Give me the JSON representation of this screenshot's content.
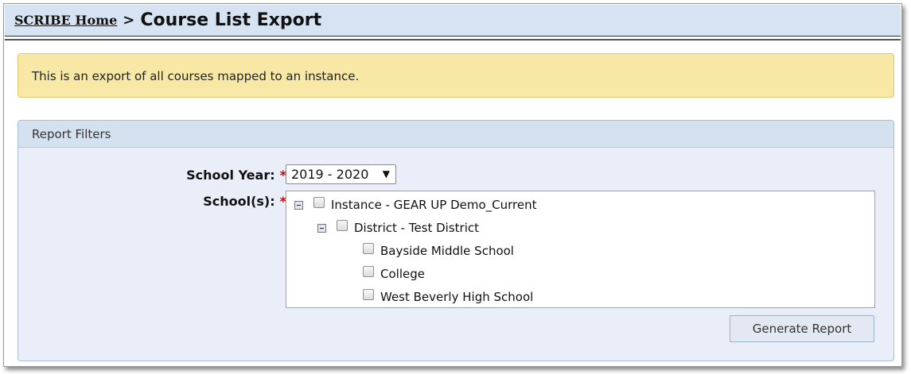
{
  "breadcrumb": {
    "home_label": "SCRIBE Home",
    "separator": ">",
    "current": "Course List Export"
  },
  "notice": {
    "text": "This is an export of all courses mapped to an instance."
  },
  "filters": {
    "heading": "Report Filters",
    "school_year": {
      "label": "School Year:",
      "required_mark": "*",
      "selected": "2019 - 2020",
      "caret": "▼"
    },
    "schools": {
      "label": "School(s):",
      "required_mark": "*",
      "tree": [
        {
          "label": "Instance - GEAR UP Demo_Current",
          "checked": false,
          "expanded": true
        },
        {
          "label": "District - Test District",
          "checked": false,
          "expanded": true
        },
        {
          "label": "Bayside Middle School",
          "checked": false
        },
        {
          "label": "College",
          "checked": false
        },
        {
          "label": "West Beverly High School",
          "checked": false
        }
      ]
    },
    "generate_button": "Generate Report"
  },
  "colors": {
    "title_bar": "#d6e3f2",
    "notice_bg": "#f7e8a6",
    "panel_bg": "#e9eef8",
    "required": "#d40000"
  }
}
